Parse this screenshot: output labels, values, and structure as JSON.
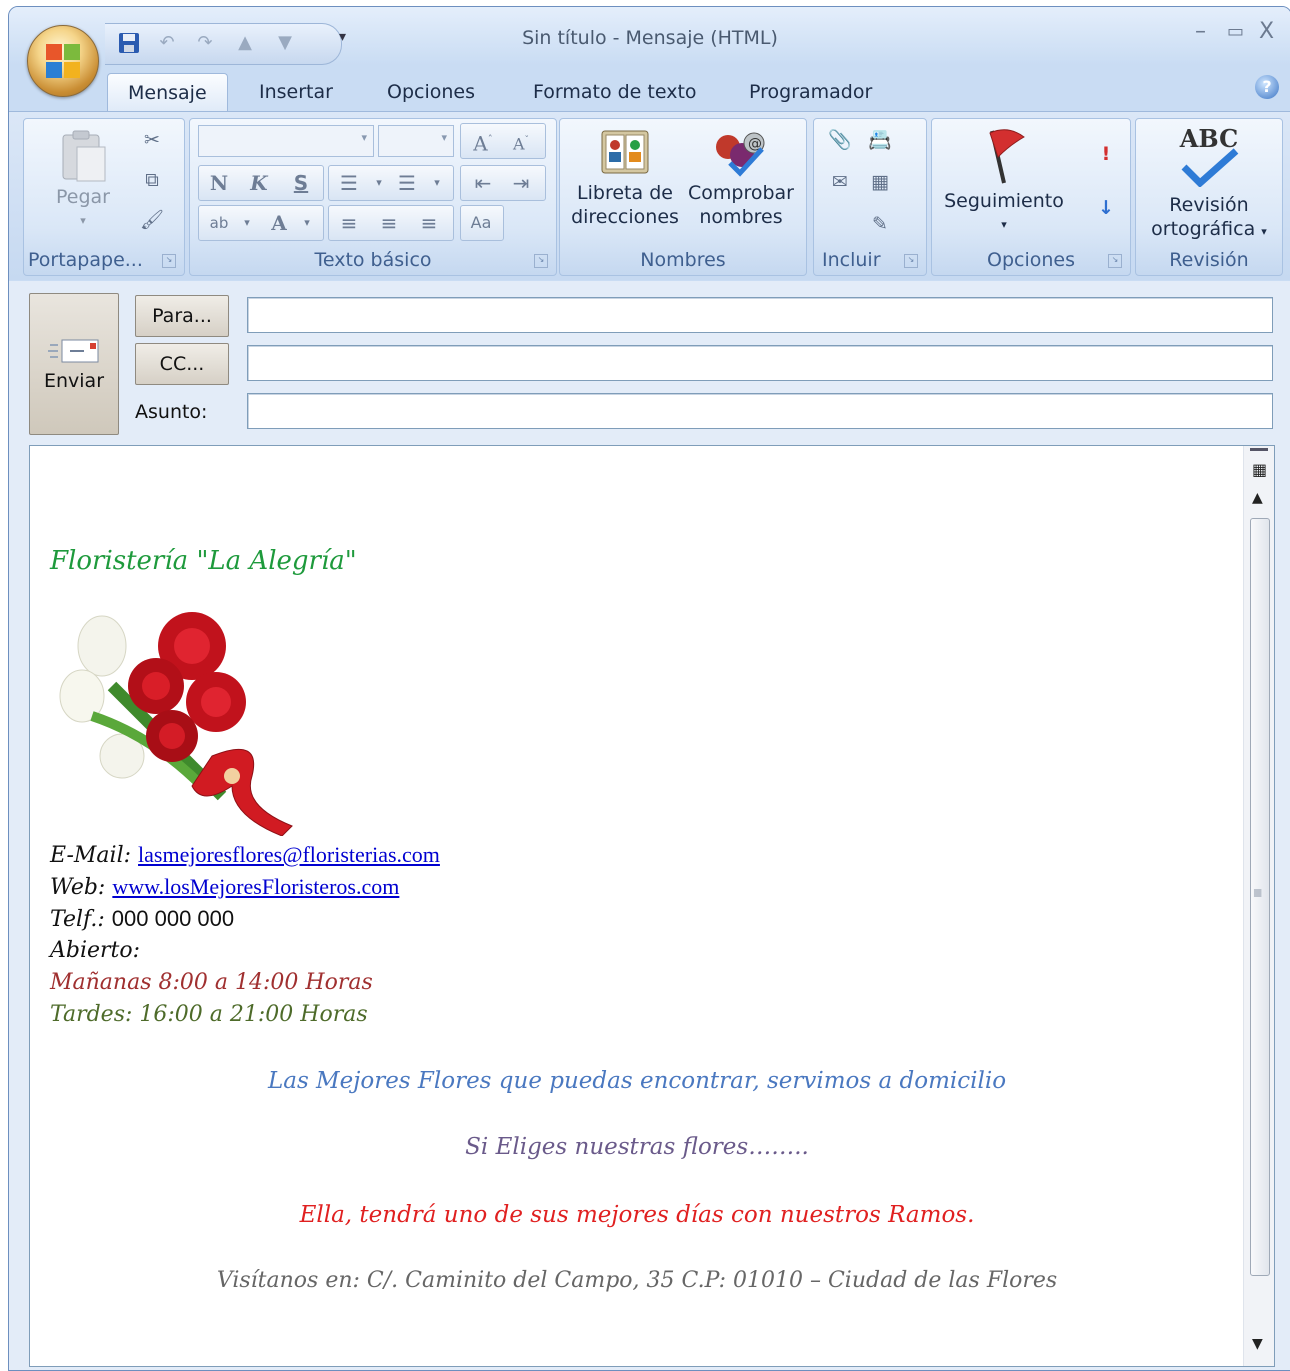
{
  "window": {
    "title": "Sin título - Mensaje (HTML)",
    "controls": {
      "minimize": "–",
      "maximize": "▭",
      "close": "X"
    }
  },
  "tabs": [
    {
      "label": "Mensaje",
      "active": true
    },
    {
      "label": "Insertar"
    },
    {
      "label": "Opciones"
    },
    {
      "label": "Formato de texto"
    },
    {
      "label": "Programador"
    }
  ],
  "ribbon": {
    "clipboard": {
      "group_label": "Portapape...",
      "paste_label": "Pegar"
    },
    "basic_text": {
      "group_label": "Texto básico",
      "bold": "N",
      "italic": "K",
      "underline": "S"
    },
    "names": {
      "group_label": "Nombres",
      "address_book": [
        "Libreta de",
        "direcciones"
      ],
      "check_names": [
        "Comprobar",
        "nombres"
      ]
    },
    "include": {
      "group_label": "Incluir"
    },
    "options": {
      "group_label": "Opciones",
      "follow_up": "Seguimiento"
    },
    "proofing": {
      "group_label": "Revisión",
      "spelling": [
        "Revisión",
        "ortográfica"
      ],
      "abc": "ABC"
    }
  },
  "composer": {
    "send_label": "Enviar",
    "to_button": "Para...",
    "cc_button": "CC...",
    "subject_label": "Asunto:",
    "to_value": "",
    "cc_value": "",
    "subject_value": ""
  },
  "signature": {
    "shop_name": "Floristería \"La Alegría\"",
    "email_label": "E-Mail:",
    "email": "lasmejoresflores@floristerias.com",
    "web_label": "Web:",
    "web": "www.losMejoresFloristeros.com",
    "phone_label": "Telf.:",
    "phone": "000 000 000",
    "open_label": "Abierto:",
    "morning": "Mañanas 8:00 a 14:00 Horas",
    "afternoon": "Tardes: 16:00 a 21:00 Horas",
    "line1": "Las Mejores Flores que puedas encontrar, servimos a domicilio",
    "line2": "Si Eliges nuestras flores……..",
    "line3": "Ella, tendrá uno de sus mejores días con nuestros Ramos.",
    "line4": "Visítanos en: C/. Caminito del Campo, 35 C.P: 01010 – Ciudad de las Flores"
  },
  "colors": {
    "shop_name": "#1e9a3c",
    "morning": "#a03030",
    "afternoon": "#4e6b2a",
    "line1": "#4a78c0",
    "line2": "#6a5a8a",
    "line3": "#e02020",
    "line4": "#666666"
  }
}
